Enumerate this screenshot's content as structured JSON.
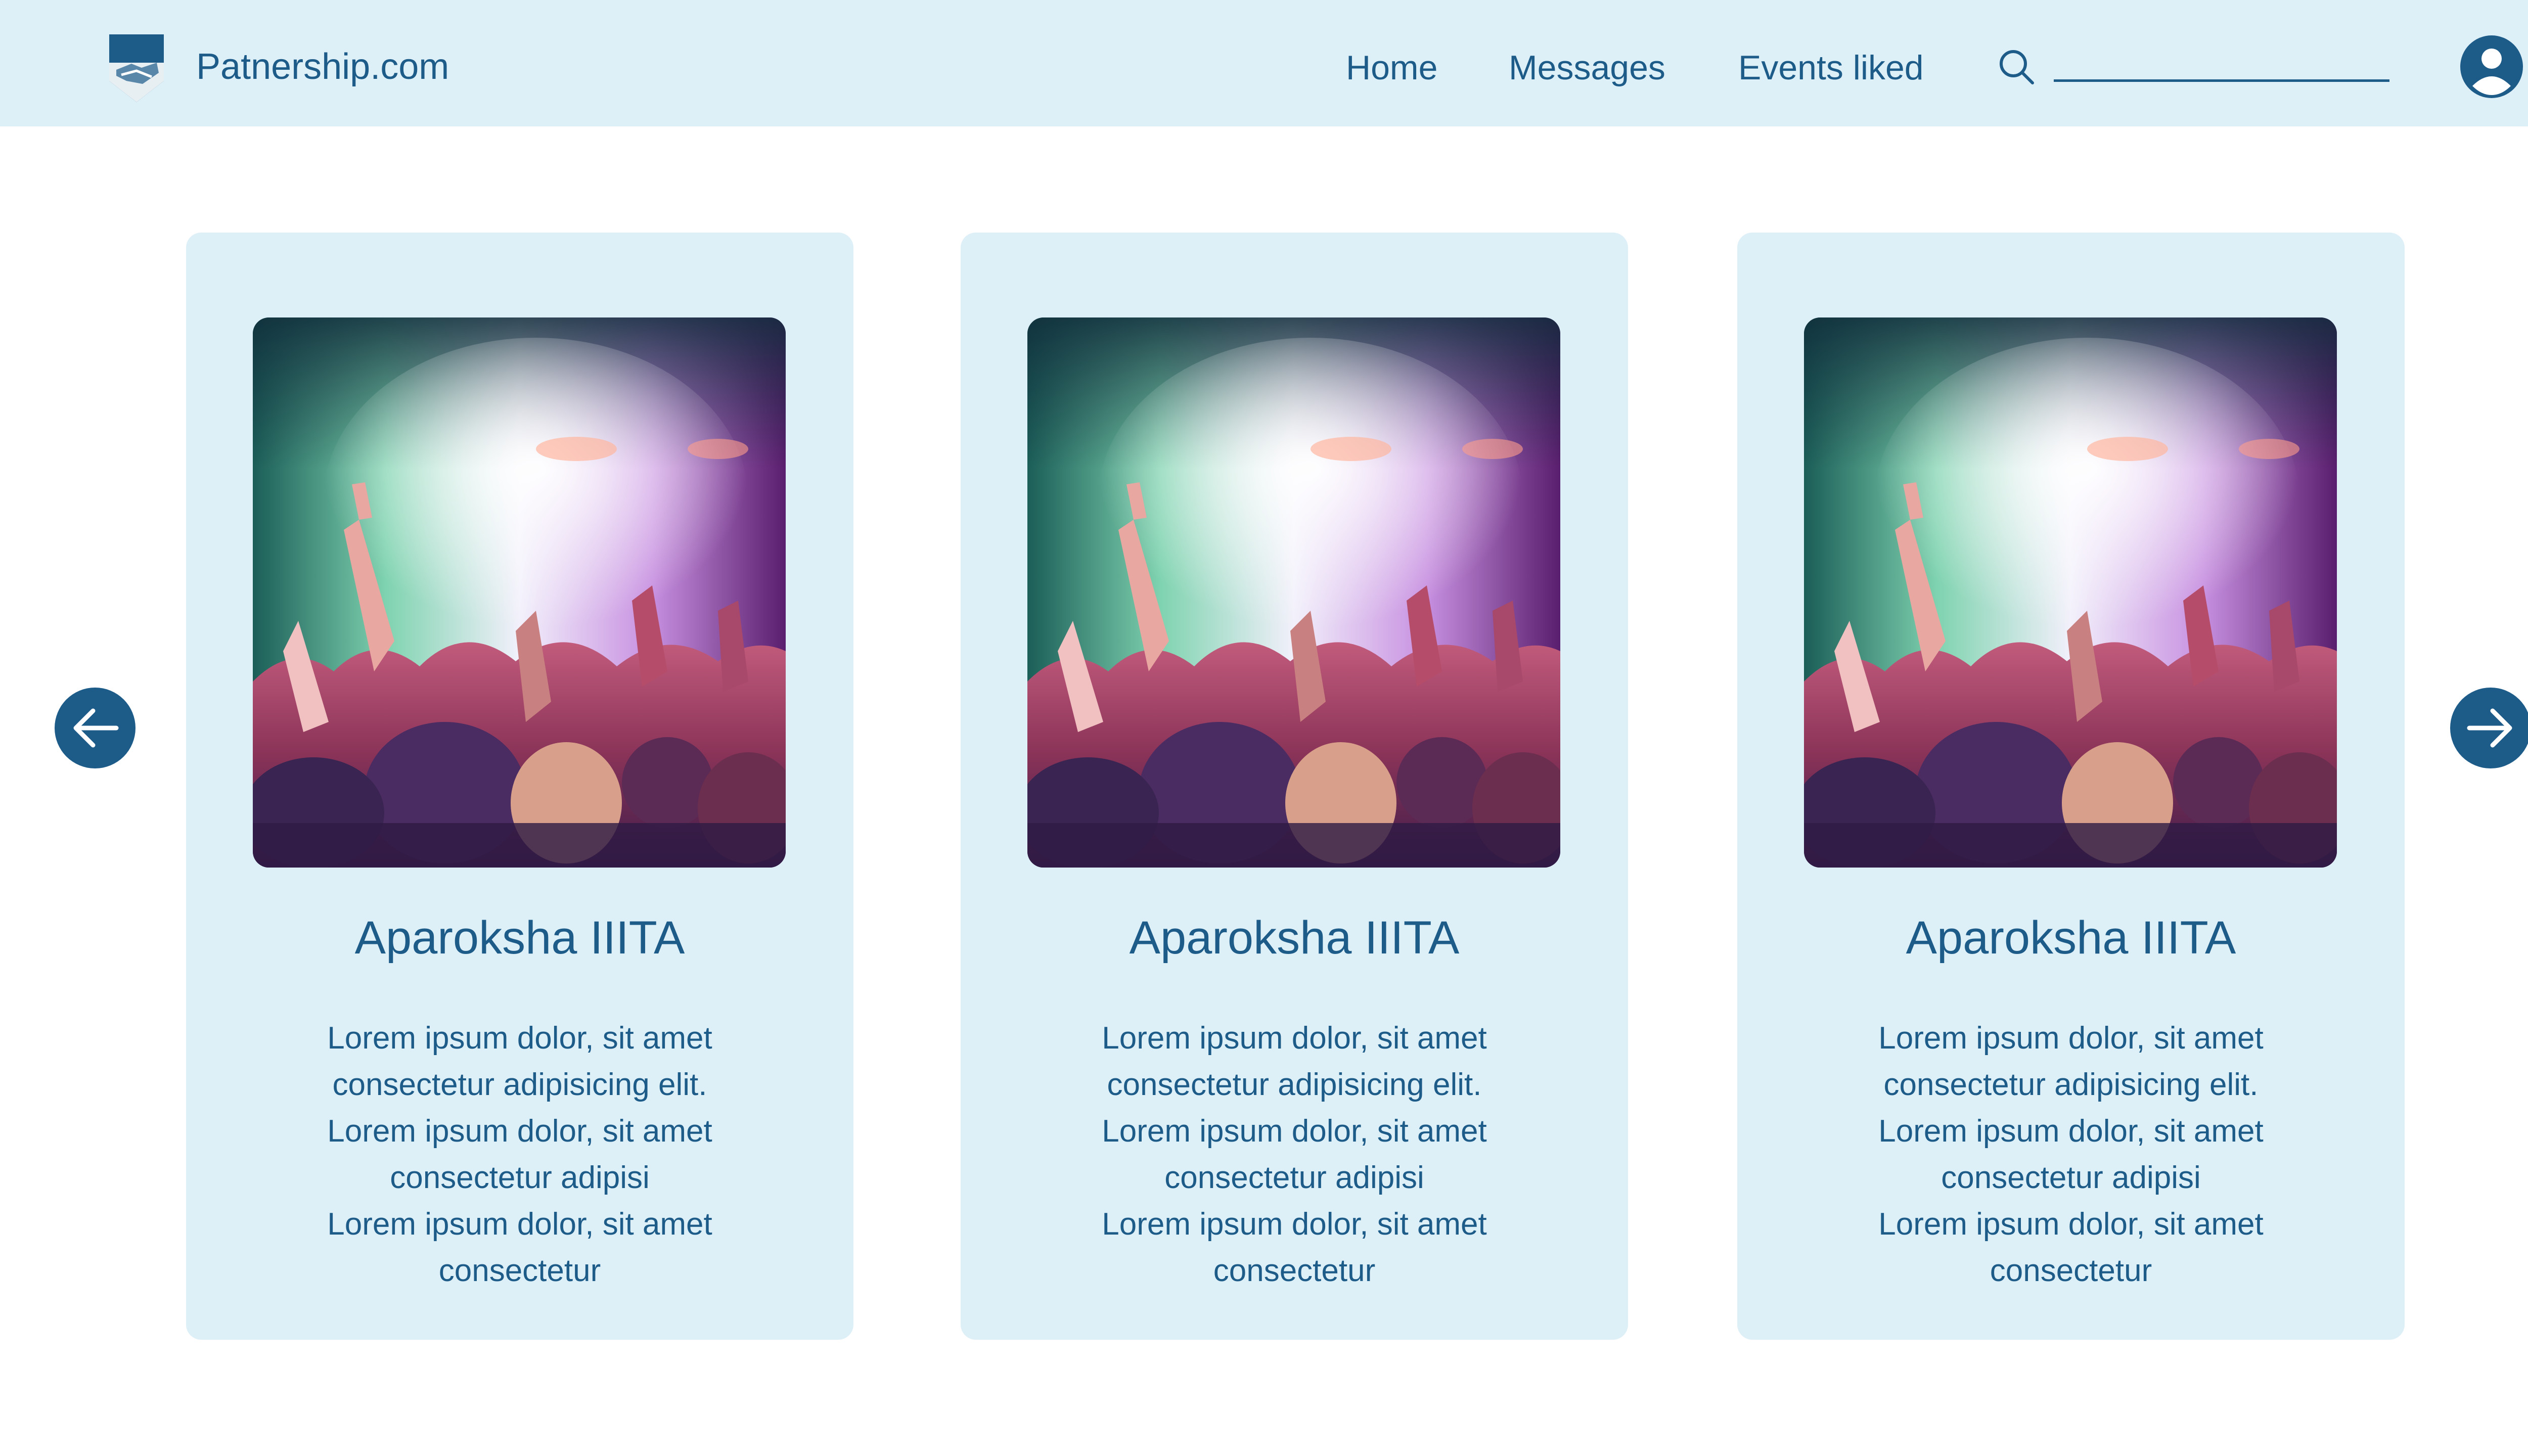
{
  "header": {
    "brand": "Patnership.com",
    "nav": [
      {
        "label": "Home"
      },
      {
        "label": "Messages"
      },
      {
        "label": "Events liked"
      }
    ],
    "search": {
      "value": "",
      "placeholder": ""
    }
  },
  "carousel": {
    "cards": [
      {
        "title": "Aparoksha IIITA",
        "lines": [
          "Lorem ipsum dolor, sit amet",
          "consectetur adipisicing elit.",
          "Lorem ipsum dolor, sit amet",
          "consectetur adipisi",
          "Lorem ipsum dolor, sit amet",
          "consectetur"
        ]
      },
      {
        "title": "Aparoksha IIITA",
        "lines": [
          "Lorem ipsum dolor, sit amet",
          "consectetur adipisicing elit.",
          "Lorem ipsum dolor, sit amet",
          "consectetur adipisi",
          "Lorem ipsum dolor, sit amet",
          "consectetur"
        ]
      },
      {
        "title": "Aparoksha IIITA",
        "lines": [
          "Lorem ipsum dolor, sit amet",
          "consectetur adipisicing elit.",
          "Lorem ipsum dolor, sit amet",
          "consectetur adipisi",
          "Lorem ipsum dolor, sit amet",
          "consectetur"
        ]
      }
    ]
  },
  "icons": {
    "logo": "handshake-shield-logo",
    "search": "search-icon",
    "avatar": "user-avatar-icon",
    "prev": "arrow-left-icon",
    "next": "arrow-right-icon",
    "image": "concert-crowd-image"
  },
  "colors": {
    "primary": "#1d5b89",
    "header_bg": "#ddeff7",
    "card_bg": "#ddeff7",
    "page_bg": "#ffffff"
  }
}
